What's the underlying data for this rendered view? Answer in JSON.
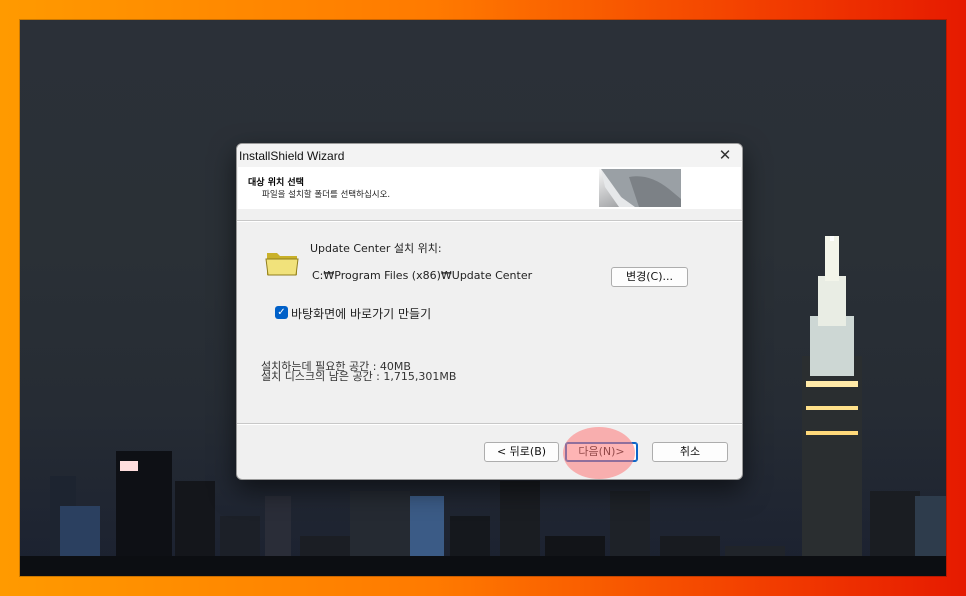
{
  "window": {
    "title": "InstallShield Wizard",
    "close_glyph": "✕"
  },
  "header": {
    "title": "대상 위치 선택",
    "subtitle": "파일을 설치할 폴더를 선택하십시오."
  },
  "destination": {
    "label": "Update Center 설치 위치:",
    "path": "C:₩Program Files (x86)₩Update Center",
    "change_button": "변경(C)..."
  },
  "shortcut": {
    "checked": true,
    "check_glyph": "✓",
    "label": "바탕화면에 바로가기 만들기"
  },
  "disk": {
    "required": "설치하는데 필요한 공간 : 40MB",
    "available": "설치 디스크의 남은 공간 : 1,715,301MB"
  },
  "buttons": {
    "back": "< 뒤로(B)",
    "next": "다음(N)>",
    "cancel": "취소"
  },
  "icons": {
    "folder": "folder-icon",
    "close": "close-icon",
    "checkbox": "checkmark-icon"
  },
  "colors": {
    "accent": "#0060c8",
    "highlight": "#ff7878",
    "frame": "#ff8a00"
  }
}
